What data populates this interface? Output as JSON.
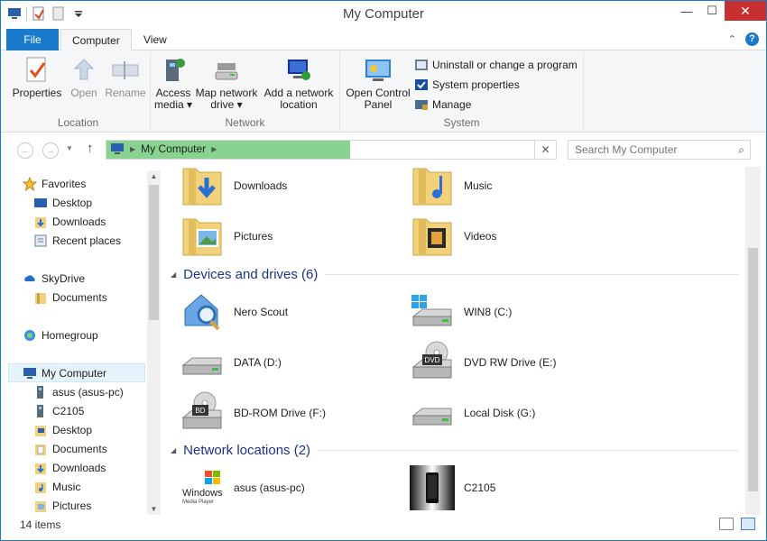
{
  "window": {
    "title": "My Computer"
  },
  "ribbon_tabs": {
    "file": "File",
    "computer": "Computer",
    "view": "View"
  },
  "ribbon": {
    "location": {
      "label": "Location",
      "properties": "Properties",
      "open": "Open",
      "rename": "Rename"
    },
    "network": {
      "label": "Network",
      "access_media_1": "Access",
      "access_media_2": "media ▾",
      "map_drive_1": "Map network",
      "map_drive_2": "drive ▾",
      "add_location_1": "Add a network",
      "add_location_2": "location"
    },
    "system": {
      "label": "System",
      "control_panel_1": "Open Control",
      "control_panel_2": "Panel",
      "uninstall": "Uninstall or change a program",
      "properties": "System properties",
      "manage": "Manage"
    }
  },
  "address": {
    "crumb": "My Computer"
  },
  "search": {
    "placeholder": "Search My Computer"
  },
  "nav": {
    "favorites": "Favorites",
    "desktop": "Desktop",
    "downloads": "Downloads",
    "recent": "Recent places",
    "skydrive": "SkyDrive",
    "sky_documents": "Documents",
    "homegroup": "Homegroup",
    "my_computer": "My Computer",
    "asus": "asus (asus-pc)",
    "c2105": "C2105",
    "mc_desktop": "Desktop",
    "mc_documents": "Documents",
    "mc_downloads": "Downloads",
    "mc_music": "Music",
    "mc_pictures": "Pictures"
  },
  "folders": [
    "Downloads",
    "Music",
    "Pictures",
    "Videos"
  ],
  "devices": {
    "header": "Devices and drives (6)",
    "items": [
      "Nero Scout",
      "WIN8 (C:)",
      "DATA (D:)",
      "DVD RW Drive (E:)",
      "BD-ROM Drive (F:)",
      "Local Disk (G:)"
    ]
  },
  "network": {
    "header": "Network locations (2)",
    "items": [
      "asus (asus-pc)",
      "C2105"
    ]
  },
  "status": {
    "count": "14 items"
  },
  "icon_text": {
    "dvd": "DVD",
    "bd": "BD",
    "windows_brand": "Windows",
    "windows_sub": "Media Player"
  }
}
